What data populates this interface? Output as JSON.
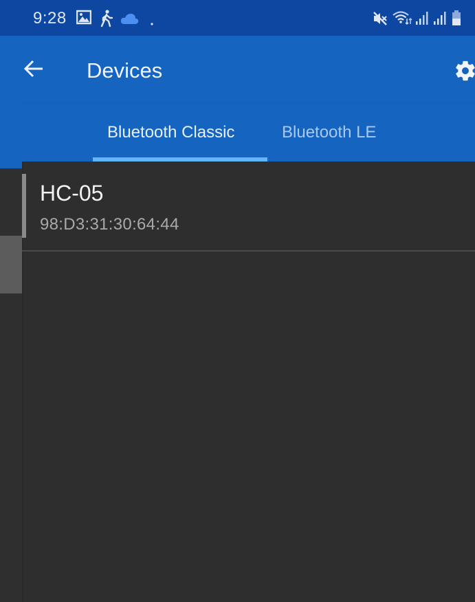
{
  "status_bar": {
    "time": "9:28",
    "left_icons": [
      "gallery-icon",
      "walking-icon",
      "cloud-icon",
      "dot-icon"
    ],
    "right_icons": [
      "mute-icon",
      "wifi-icon",
      "signal-icon",
      "signal-icon",
      "battery-icon"
    ]
  },
  "app_bar": {
    "title": "Devices",
    "back_icon": "arrow-left-icon",
    "settings_icon": "gear-icon"
  },
  "tabs": [
    {
      "label": "Bluetooth Classic",
      "selected": true
    },
    {
      "label": "Bluetooth LE",
      "selected": false
    }
  ],
  "devices": [
    {
      "name": "HC-05",
      "address": "98:D3:31:30:64:44"
    }
  ],
  "colors": {
    "status_bar": "#0d47a1",
    "primary": "#1565c0",
    "tab_indicator": "#64b5f6",
    "background": "#2e2e2e"
  }
}
